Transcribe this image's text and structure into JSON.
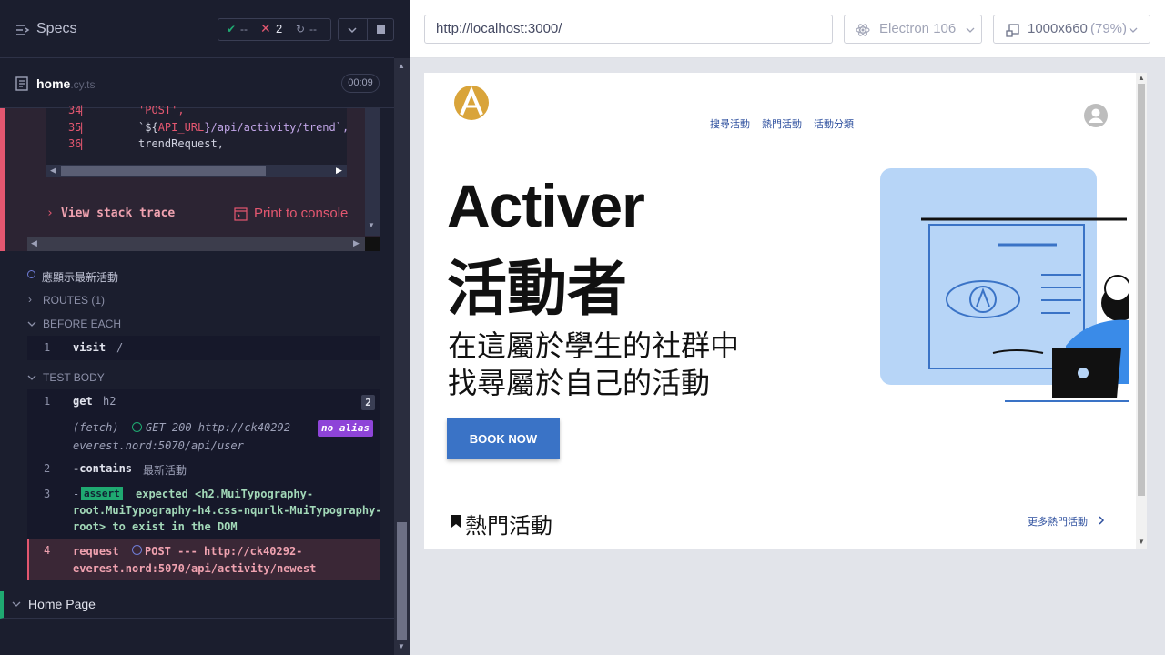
{
  "reporter": {
    "title": "Specs",
    "stats": {
      "passed": "--",
      "failed": "2",
      "pending": "--"
    },
    "spec_file": "home",
    "spec_ext": ".cy.ts",
    "timer": "00:09",
    "code_lines": [
      {
        "num": "34",
        "text": "'POST',"
      },
      {
        "num": "35",
        "text_pre": "`${",
        "text_var": "API_URL",
        "text_post": "}/api/activity/trend`,"
      },
      {
        "num": "36",
        "text": "trendRequest,"
      }
    ],
    "stack_trace_label": "View stack trace",
    "print_console_label": "Print to console",
    "test_title": "應顯示最新活動",
    "routes_label": "ROUTES (1)",
    "before_each_label": "BEFORE EACH",
    "before_each_cmd": {
      "num": "1",
      "name": "visit",
      "arg": "/"
    },
    "test_body_label": "TEST BODY",
    "cmds": {
      "c1": {
        "num": "1",
        "name": "get",
        "arg": "h2",
        "badge": "2"
      },
      "fetch": {
        "label": "(fetch)",
        "text1": "GET 200 http://ck40292-",
        "text2": "everest.nord:5070/api/user",
        "alias": "no alias"
      },
      "c2": {
        "num": "2",
        "name": "-contains",
        "arg": "最新活動"
      },
      "c3": {
        "num": "3",
        "dash": "-",
        "badge": "assert",
        "line1": "expected <h2.MuiTypography-",
        "line2": "root.MuiTypography-h4.css-nqurlk-MuiTypography-",
        "line3": "root> to exist in the DOM"
      },
      "c4": {
        "num": "4",
        "name": "request",
        "text1": "POST --- http://ck40292-",
        "text2": "everest.nord:5070/api/activity/newest"
      }
    },
    "suite_label": "Home Page"
  },
  "browser": {
    "url": "http://localhost:3000/",
    "name": "Electron 106",
    "viewport": "1000x660",
    "zoom": "(79%)"
  },
  "site": {
    "nav": [
      "搜尋活動",
      "熱門活動",
      "活動分類"
    ],
    "hero_title_en": "Activer",
    "hero_title_zh": "活動者",
    "hero_sub1": "在這屬於學生的社群中",
    "hero_sub2": "找尋屬於自己的活動",
    "book_now": "BOOK NOW",
    "popular_title": "熱門活動",
    "more_popular": "更多熱門活動"
  },
  "colors": {
    "accent_red": "#e45770",
    "accent_green": "#1fa971",
    "brand_blue": "#3a73c6",
    "alias_purple": "#8e44d8"
  }
}
